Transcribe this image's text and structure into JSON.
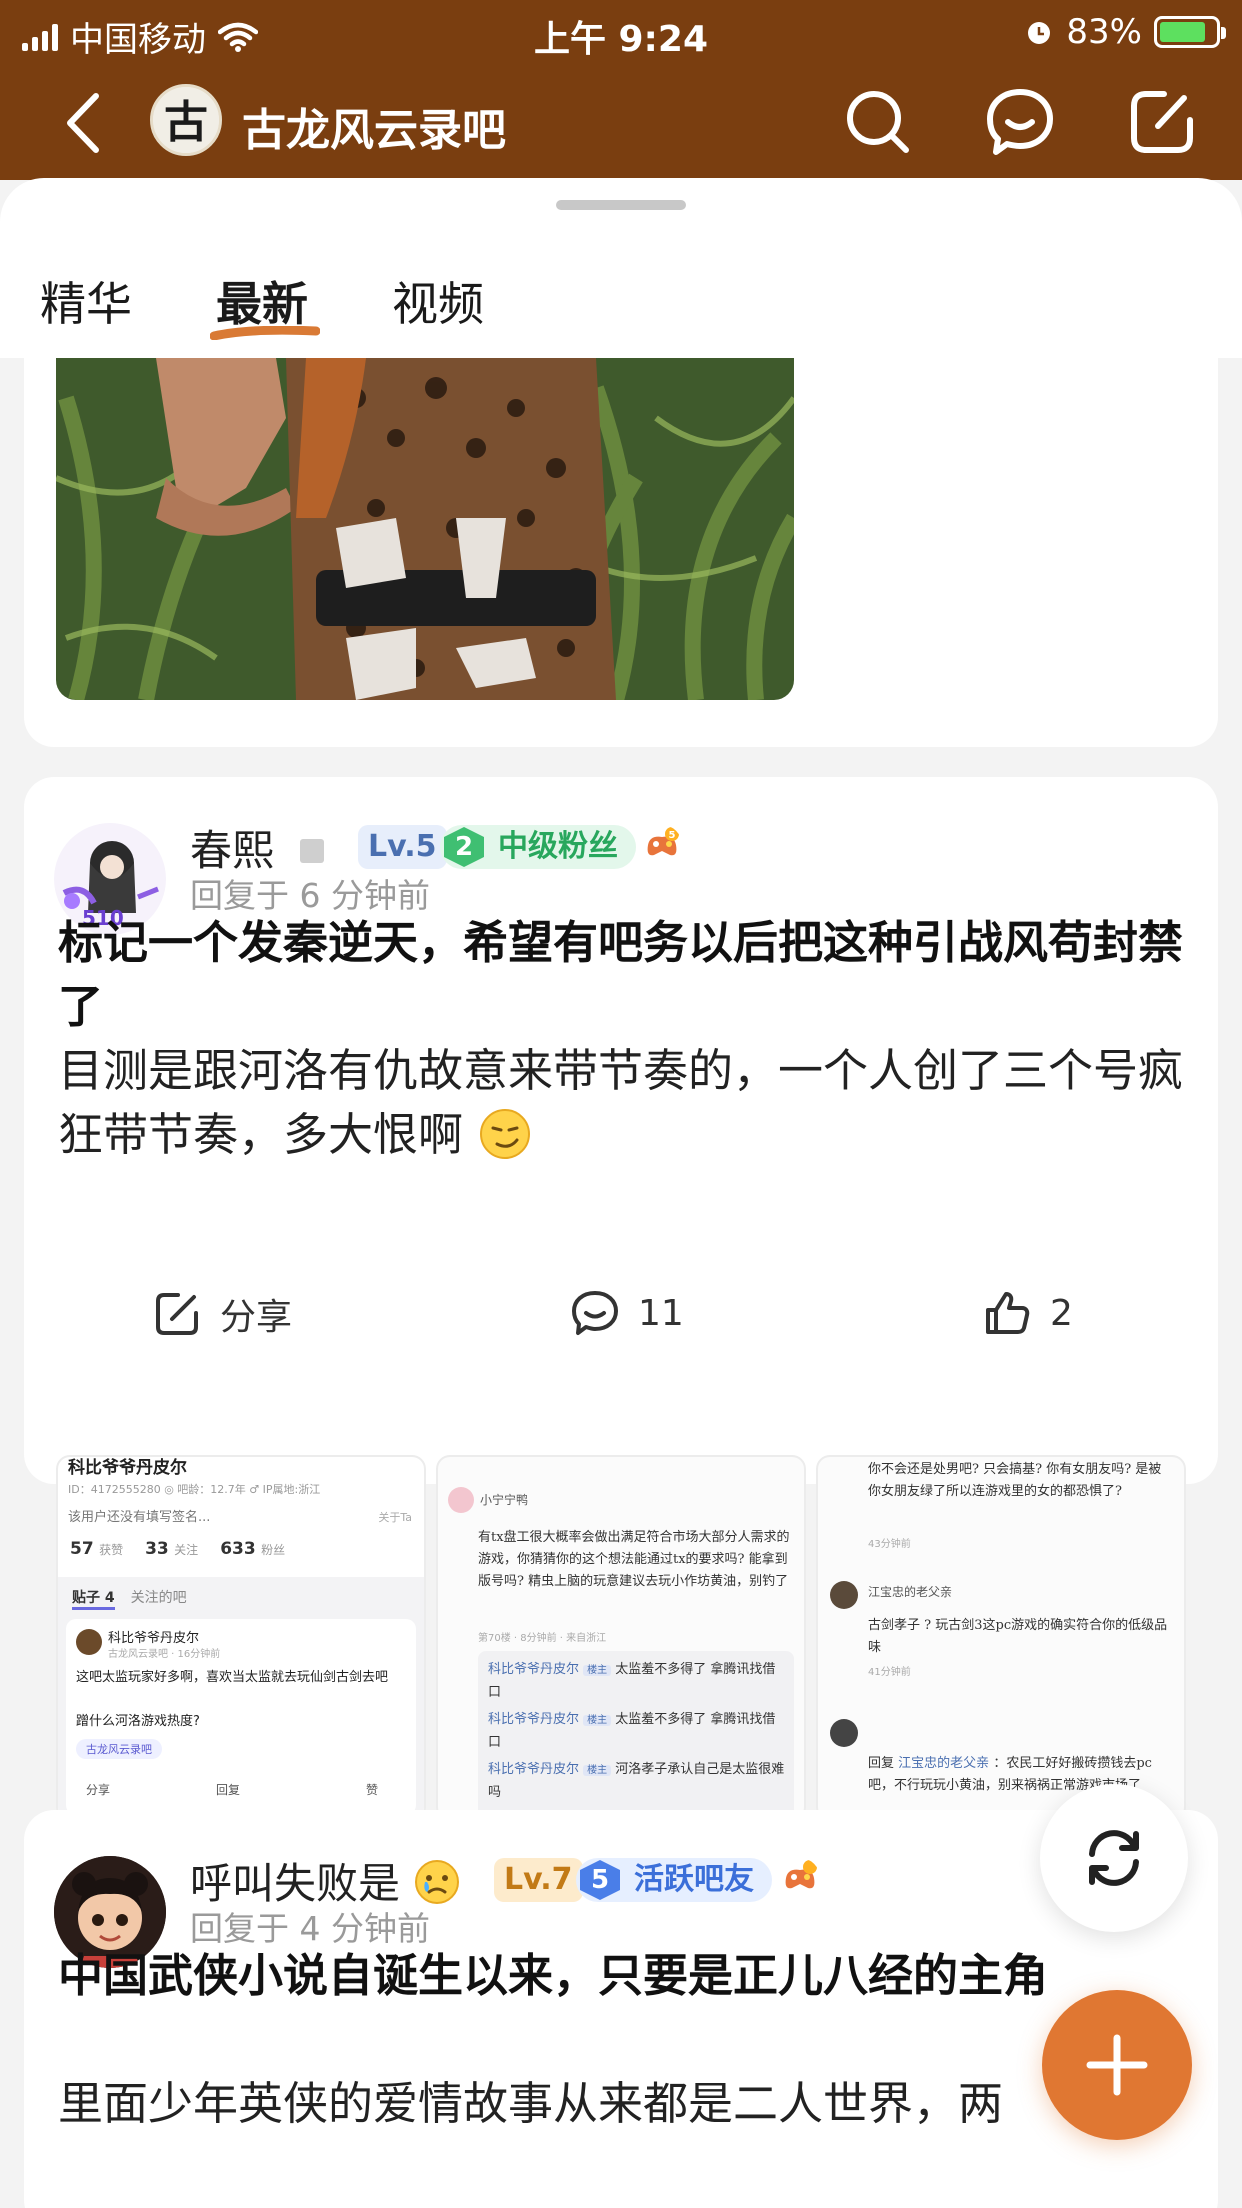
{
  "status_bar": {
    "carrier": "中国移动",
    "time": "上午 9:24",
    "battery": "83%",
    "battery_level": 0.83
  },
  "header": {
    "forum_name": "古龙风云录吧",
    "logo_char": "古"
  },
  "tabs": [
    {
      "label": "精华",
      "active": false
    },
    {
      "label": "最新",
      "active": true
    },
    {
      "label": "视频",
      "active": false
    }
  ],
  "posts": [
    {
      "user": {
        "name": "春熙",
        "level": "Lv.5",
        "fan_rank": "2",
        "fan_title": "中级粉丝"
      },
      "time": "回复于 6 分钟前",
      "title": "标记一个发秦逆天，希望有吧务以后把这种引战风苟封禁了",
      "body": "目测是跟河洛有仇故意来带节奏的，一个人创了三个号疯狂带节奏，多大恨啊",
      "thumb1": {
        "name": "科比爷爷丹皮尔",
        "id_line": "ID：4172555280 ◎ 吧龄：12.7年 ♂ IP属地:浙江",
        "sign": "该用户还没有填写签名...",
        "sign_link": "关于Ta",
        "likes": "57",
        "likes_label": "获赞",
        "follows": "33",
        "follows_label": "关注",
        "fans": "633",
        "fans_label": "粉丝",
        "tab_posts": "贴子 4",
        "tab_forums": "关注的吧",
        "sub_user": "科比爷爷丹皮尔",
        "sub_meta": "古龙风云录吧 · 16分钟前",
        "sub_text": "这吧太监玩家好多啊，喜欢当太监就去玩仙剑古剑去吧",
        "sub_text2": "蹭什么河洛游戏热度?",
        "sub_tag": "古龙风云录吧",
        "btn_share": "分享",
        "btn_reply": "回复",
        "btn_like": "赞"
      },
      "thumb2": {
        "user": "小宁宁鸭",
        "text": "有tx盘工很大概率会做出满足符合市场大部分人需求的游戏，你猜猜你的这个想法能通过tx的要求吗? 能拿到版号吗? 精虫上脑的玩意建议去玩小作坊黄油，别钓了",
        "meta": "第70楼 · 8分钟前 · 来自浙江",
        "replies": [
          {
            "who": "科比爷爷丹皮尔",
            "tag": "楼主",
            "text": "太监羞不多得了 拿腾讯找借口"
          },
          {
            "who": "科比爷爷丹皮尔",
            "tag": "楼主",
            "text": "太监羞不多得了 拿腾讯找借口"
          },
          {
            "who": "科比爷爷丹皮尔",
            "tag": "楼主",
            "text": "河洛孝子承认自己是太监很难吗"
          }
        ]
      },
      "thumb3": {
        "top_text": "你不会还是处男吧? 只会搞基? 你有女朋友吗? 是被你女朋友绿了所以连游戏里的女的都恐惧了?",
        "top_meta": "43分钟前",
        "c1_user": "江宝忠的老父亲",
        "c1_text": "古剑孝子 ? 玩古剑3这pc游戏的确实符合你的低级品味",
        "c1_meta": "41分钟前",
        "c2_prefix": "回复",
        "c2_user": "江宝忠的老父亲",
        "c2_text": "：农民工好好搬砖攒钱去pc吧，不行玩玩小黄油，别来祸祸正常游戏市场了"
      },
      "actions": {
        "share": "分享",
        "comments": "11",
        "likes": "2"
      }
    },
    {
      "user": {
        "name": "呼叫失败是",
        "level": "Lv.7",
        "fan_rank": "5",
        "fan_title": "活跃吧友"
      },
      "time": "回复于 4 分钟前",
      "title": "中国武侠小说自诞生以来，只要是正儿八经的主角",
      "body": "里面少年英侠的爱情故事从来都是二人世界，两"
    }
  ],
  "colors": {
    "header_brown": "#7a3e10",
    "fab_orange": "#e07732",
    "fan_green": "#3fbf72",
    "fan_blue": "#4a7ee8"
  }
}
